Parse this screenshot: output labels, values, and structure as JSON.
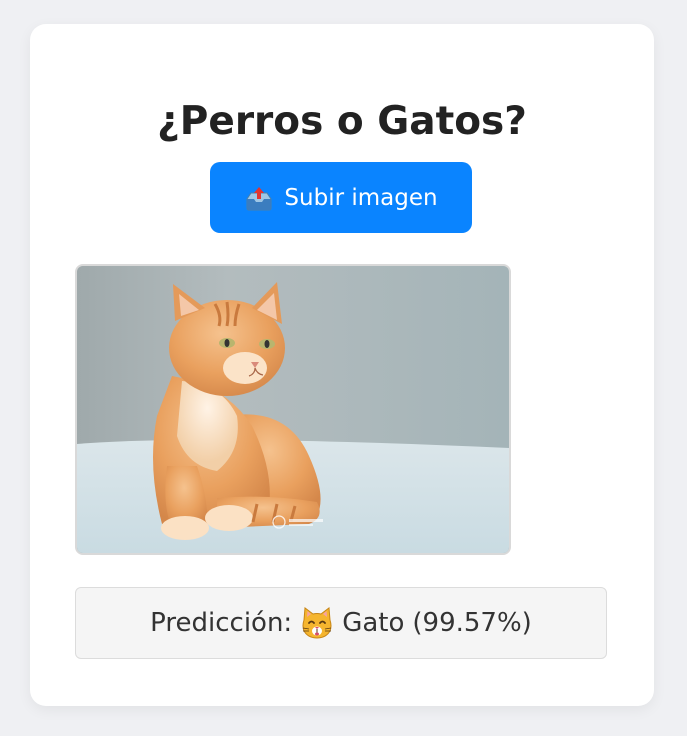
{
  "app": {
    "title": "¿Perros o Gatos?"
  },
  "upload": {
    "icon": "upload-tray-icon",
    "label": "Subir imagen"
  },
  "preview": {
    "image": "orange-tabby-cat-photo"
  },
  "prediction": {
    "label": "Predicción:",
    "icon": "cat-face-icon",
    "class": "Gato",
    "confidence": "(99.57%)"
  },
  "colors": {
    "background": "#eff0f3",
    "card": "#ffffff",
    "accent": "#0a84ff",
    "result_bg": "#f5f5f5"
  }
}
